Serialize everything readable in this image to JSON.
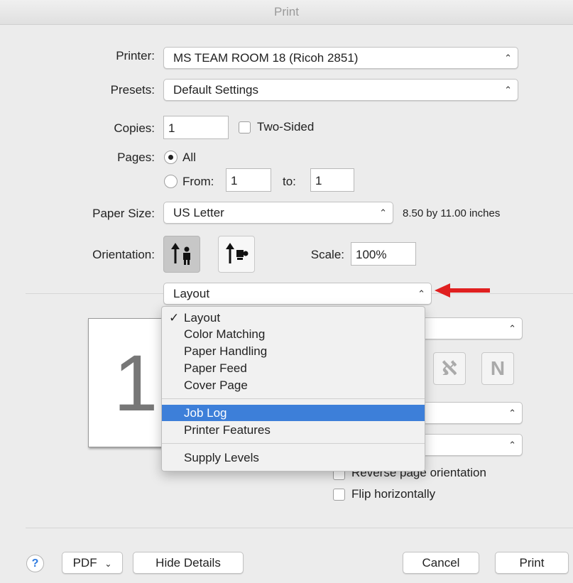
{
  "window": {
    "title": "Print"
  },
  "printer": {
    "label": "Printer:",
    "value": "MS TEAM ROOM 18 (Ricoh 2851)"
  },
  "presets": {
    "label": "Presets:",
    "value": "Default Settings"
  },
  "copies": {
    "label": "Copies:",
    "value": "1",
    "two_sided_label": "Two-Sided",
    "two_sided_checked": false
  },
  "pages": {
    "label": "Pages:",
    "all_label": "All",
    "all_selected": true,
    "from_label": "From:",
    "from_value": "1",
    "to_label": "to:",
    "to_value": "1"
  },
  "paper_size": {
    "label": "Paper Size:",
    "value": "US Letter",
    "dimensions": "8.50 by 11.00 inches"
  },
  "orientation": {
    "label": "Orientation:",
    "selected": "portrait"
  },
  "scale": {
    "label": "Scale:",
    "value": "100%"
  },
  "section_popup": {
    "value": "Layout"
  },
  "section_menu": {
    "items": [
      {
        "label": "Layout",
        "checked": true
      },
      {
        "label": "Color Matching"
      },
      {
        "label": "Paper Handling"
      },
      {
        "label": "Paper Feed"
      },
      {
        "label": "Cover Page"
      },
      {
        "label": "Job Log",
        "highlighted": true
      },
      {
        "label": "Printer Features"
      },
      {
        "label": "Supply Levels"
      }
    ]
  },
  "preview": {
    "page_number": "1"
  },
  "layout_options": {
    "reverse_orientation_label": "Reverse page orientation",
    "flip_horizontally_label": "Flip horizontally"
  },
  "footer": {
    "help_label": "?",
    "pdf_label": "PDF",
    "hide_details_label": "Hide Details",
    "cancel_label": "Cancel",
    "print_label": "Print"
  },
  "colors": {
    "highlight": "#3d7fd9",
    "arrow": "#e02020"
  }
}
